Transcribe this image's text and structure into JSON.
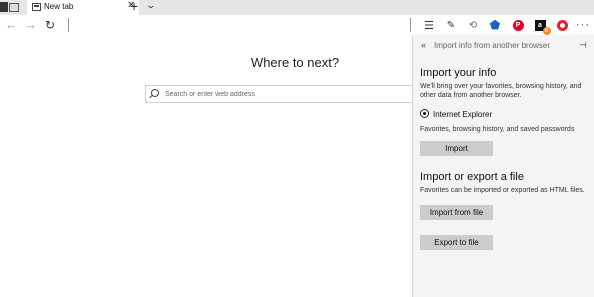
{
  "tab": {
    "title": "New tab",
    "close": "✕",
    "new_tab": "+",
    "dropdown": "⌄"
  },
  "nav": {
    "back": "←",
    "forward": "→",
    "refresh": "↻"
  },
  "toolbar": {
    "hub": "☰",
    "note": "✎",
    "share": "⟲",
    "ext_blue": "⬟",
    "pinterest": "P",
    "amazon": "a",
    "amazon_badge": "0",
    "more": "···"
  },
  "main": {
    "headline": "Where to next?",
    "search_placeholder": "Search or enter web address"
  },
  "panel": {
    "back": "«",
    "title": "Import info from another browser",
    "pin": "⊣",
    "import_title": "Import your info",
    "import_desc": "We'll bring over your favorites, browsing history, and other data from another browser.",
    "browser_option": "Internet Explorer",
    "browser_desc": "Favorites, browsing history, and saved passwords",
    "import_button": "Import",
    "file_title": "Import or export a file",
    "file_desc": "Favorites can be imported or exported as HTML files.",
    "import_file_button": "Import from file",
    "export_file_button": "Export to file"
  },
  "colors": {
    "pinterest": "#e60023",
    "opera": "#e4202f",
    "amazon_badge": "#f28c1b",
    "button_bg": "#cccccc",
    "panel_bg": "#f4f4f4"
  }
}
